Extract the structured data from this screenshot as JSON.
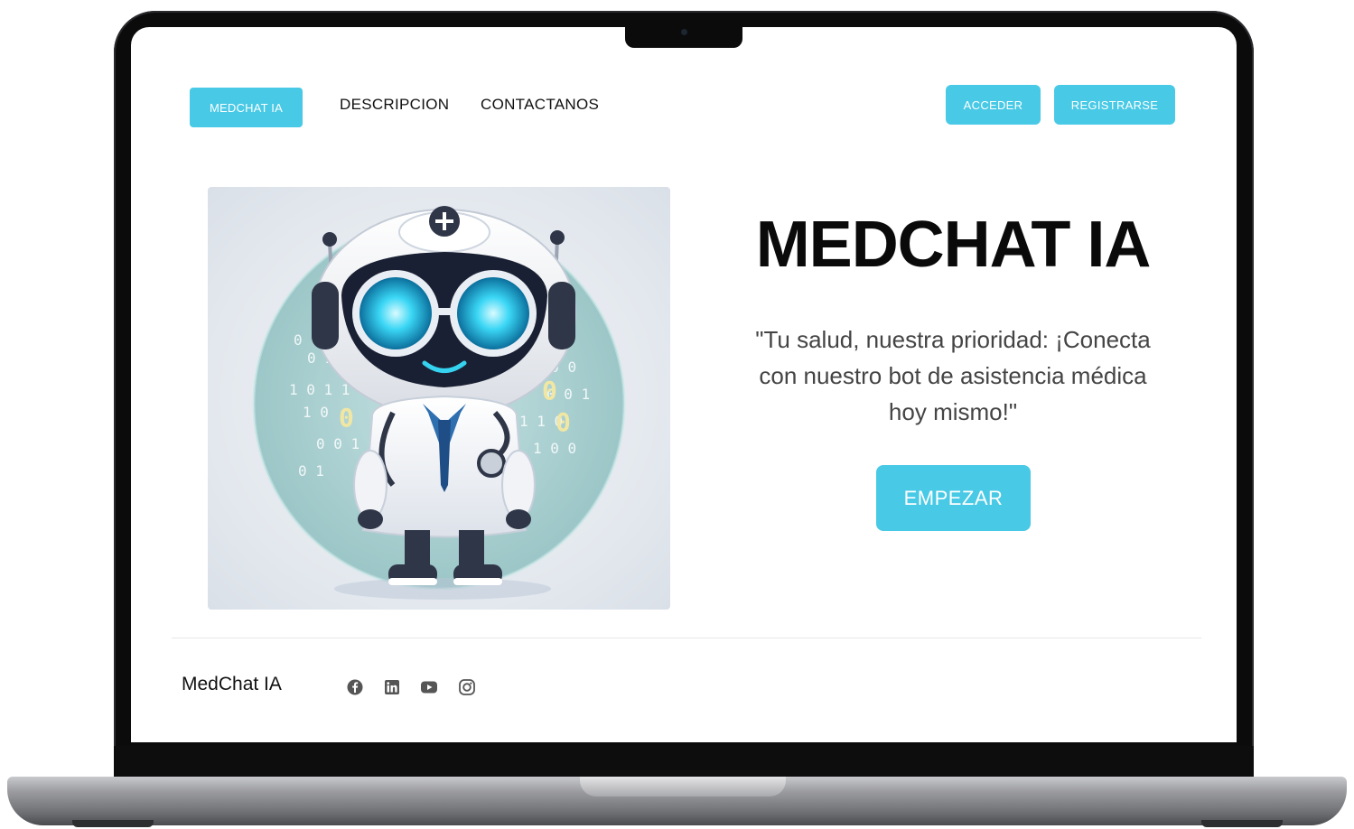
{
  "nav": {
    "brand": "MEDCHAT IA",
    "links": [
      "DESCRIPCION",
      "CONTACTANOS"
    ],
    "login": "ACCEDER",
    "register": "REGISTRARSE"
  },
  "hero": {
    "title": "MEDCHAT IA",
    "subtitle": "\"Tu salud, nuestra prioridad: ¡Conecta con nuestro bot de asistencia médica hoy mismo!\"",
    "cta": "EMPEZAR",
    "image_icon": "doctor-robot-illustration"
  },
  "footer": {
    "brand": "MedChat IA",
    "social": [
      "facebook-icon",
      "linkedin-icon",
      "youtube-icon",
      "instagram-icon"
    ]
  },
  "colors": {
    "accent": "#48c9e5",
    "text": "#111111",
    "subtitle": "#444444"
  }
}
